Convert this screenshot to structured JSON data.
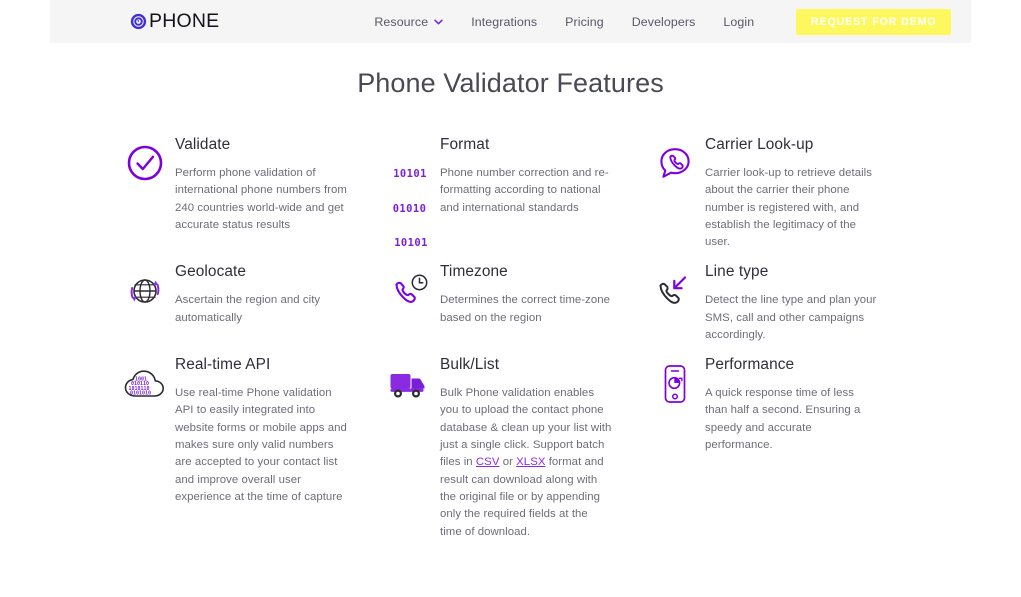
{
  "colors": {
    "accent_purple": "#7d00e0",
    "dark_icon": "#2b2b33",
    "cta_yellow": "#fdf85e",
    "header_bg": "#f5f5f5",
    "title_text": "#4a4a55",
    "body_text": "#6d6c7a",
    "link_purple": "#8a2be2"
  },
  "header": {
    "logo_text": "PHONE",
    "logo_icon": "phone-ring-logo-icon",
    "nav": [
      {
        "label": "Resource",
        "has_dropdown": true,
        "icon": "chevron-down-icon"
      },
      {
        "label": "Integrations",
        "has_dropdown": false
      },
      {
        "label": "Pricing",
        "has_dropdown": false
      },
      {
        "label": "Developers",
        "has_dropdown": false
      },
      {
        "label": "Login",
        "has_dropdown": false
      }
    ],
    "cta_label": "REQUEST FOR DEMO"
  },
  "main": {
    "title": "Phone Validator Features",
    "features": [
      {
        "icon": "check-circle-icon",
        "title": "Validate",
        "desc": "Perform phone validation of international phone numbers from 240 countries world-wide and get accurate status results"
      },
      {
        "icon": "binary-digits-icon",
        "binary_lines": [
          "10101",
          "01010",
          "10101"
        ],
        "title": "Format",
        "desc": "Phone number correction and re-formatting according to national and international standards"
      },
      {
        "icon": "speech-bubble-phone-icon",
        "title": "Carrier Look-up",
        "desc": "Carrier look-up to retrieve details about the carrier their phone number is registered with, and establish the legitimacy of the user."
      },
      {
        "icon": "globe-refresh-icon",
        "title": "Geolocate",
        "desc": "Ascertain the region and city automatically"
      },
      {
        "icon": "phone-clock-icon",
        "title": "Timezone",
        "desc": "Determines the correct time-zone based on the region"
      },
      {
        "icon": "phone-incoming-arrow-icon",
        "title": "Line type",
        "desc": "Detect the line type and plan your SMS, call and other campaigns accordingly."
      },
      {
        "icon": "cloud-binary-icon",
        "title": "Real-time API",
        "desc": "Use real-time Phone validation API to easily integrated into website forms or mobile apps and makes sure only valid numbers are accepted to your contact list and improve overall user experience at the time of capture"
      },
      {
        "icon": "delivery-truck-icon",
        "title": "Bulk/List",
        "desc_part1": "Bulk Phone validation enables you to upload the contact phone database & clean up your list with just a single click. Support batch files in ",
        "link1": "CSV",
        "desc_mid": " or ",
        "link2": "XLSX",
        "desc_part2": " format and result can download along with the original file or by appending only the required fields at the time of download."
      },
      {
        "icon": "phone-pie-chart-icon",
        "title": "Performance",
        "desc": "A quick response time of less than half a second. Ensuring a speedy and accurate performance."
      }
    ]
  }
}
